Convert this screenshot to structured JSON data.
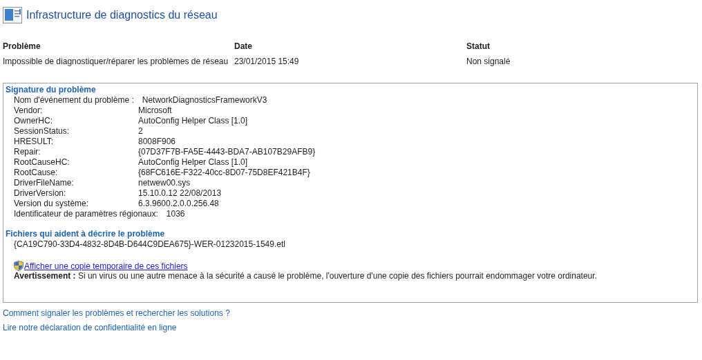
{
  "window": {
    "title": "Infrastructure de diagnostics du réseau"
  },
  "summary": {
    "columns": [
      "Problème",
      "Date",
      "Statut"
    ],
    "values": [
      "Impossible de diagnostiquer/réparer les problèmes de réseau",
      "23/01/2015 15:49",
      "Non signalé"
    ]
  },
  "signature": {
    "title": "Signature du problème",
    "rows": [
      {
        "label": "Nom d'événement du problème :",
        "value": "NetworkDiagnosticsFrameworkV3"
      },
      {
        "label": "Vendor:",
        "value": "Microsoft"
      },
      {
        "label": "OwnerHC:",
        "value": "AutoConfig Helper Class [1.0]"
      },
      {
        "label": "SessionStatus:",
        "value": "2"
      },
      {
        "label": "HRESULT:",
        "value": "8008F906"
      },
      {
        "label": "Repair:",
        "value": "{07D37F7B-FA5E-4443-BDA7-AB107B29AFB9}"
      },
      {
        "label": "RootCauseHC:",
        "value": "AutoConfig Helper Class [1.0]"
      },
      {
        "label": "RootCause:",
        "value": "{68FC616E-F322-40cc-8D07-75D8EF421B4F}"
      },
      {
        "label": "DriverFileName:",
        "value": "netwew00.sys"
      },
      {
        "label": "DriverVersion:",
        "value": "15.10.0.12 22/08/2013"
      },
      {
        "label": "Version du système:",
        "value": "6.3.9600.2.0.0.256.48"
      },
      {
        "label": "Identificateur de paramètres régionaux:",
        "value": "1036"
      }
    ]
  },
  "files": {
    "title": "Fichiers qui aident à décrire le problème",
    "items": [
      "{CA19C790-33D4-4832-8D4B-D644C9DEA675}-WER-01232015-1549.etl"
    ],
    "view_link": "Afficher une copie temporaire de ces fichiers",
    "warning": "**Avertissement :** Si un virus ou une autre menace à la sécurité a causé le problème, l'ouverture d'une copie des fichiers pourrait endommager votre ordinateur."
  },
  "links": [
    "Comment signaler les problèmes et rechercher les solutions ?",
    "Lire notre déclaration de confidentialité en ligne"
  ]
}
